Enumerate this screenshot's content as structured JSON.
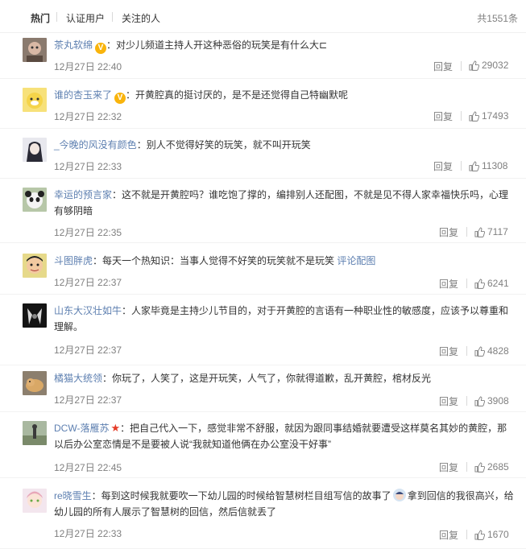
{
  "tabs": [
    "热门",
    "认证用户",
    "关注的人"
  ],
  "total": "共1551条",
  "actions": {
    "reply_label": "回复"
  },
  "colors": {
    "username_orange": "#eb7350",
    "username_blue": "#5d7fb0",
    "link": "#5d7fb0",
    "meta": "#808080"
  },
  "comments": [
    {
      "user": "茶丸软绵",
      "badge": "v-icon",
      "text": "：对少儿频道主持人开这种恶俗的玩笑是有什么大⊏",
      "time": "12月27日 22:40",
      "likes": "29032"
    },
    {
      "user": "谁的杏玉来了",
      "badge": "v-icon",
      "text": "：开黄腔真的挺讨厌的，是不是还觉得自己特幽默呢",
      "time": "12月27日 22:32",
      "likes": "17493"
    },
    {
      "user": "_今晚的风没有颜色",
      "text": "：别人不觉得好笑的玩笑，就不叫开玩笑",
      "time": "12月27日 22:33",
      "likes": "11308"
    },
    {
      "user": "幸运的预言家",
      "text": "：这不就是开黄腔吗？谁吃饱了撑的，编排别人还配图，不就是见不得人家幸福快乐吗，心理有够阴暗",
      "time": "12月27日 22:35",
      "likes": "7117"
    },
    {
      "user": "斗图胖虎",
      "text": "：每天一个热知识：当事人觉得不好笑的玩笑就不是玩笑 ",
      "link": "评论配图",
      "time": "12月27日 22:37",
      "likes": "6241"
    },
    {
      "user": "山东大汉壮如牛",
      "text": "：人家毕竟是主持少儿节目的，对于开黄腔的言语有一种职业性的敏感度，应该予以尊重和理解。",
      "time": "12月27日 22:37",
      "likes": "4828"
    },
    {
      "user": "橘猫大统领",
      "text": "：你玩了，人笑了，这是开玩笑，人气了，你就得道歉，乱开黄腔，棺材反光",
      "time": "12月27日 22:37",
      "likes": "3908"
    },
    {
      "user": "DCW-落雁苏",
      "badge": "star-icon",
      "text": "：把自己代入一下，感觉非常不舒服，就因为跟同事结婚就要遭受这样莫名其妙的黄腔，那以后办公室恋情是不是要被人说“我就知道他俩在办公室没干好事”",
      "time": "12月27日 22:45",
      "likes": "2685"
    },
    {
      "user": "re晓雪生",
      "text": "：每到这时候我就要吹一下幼儿园的时候给智慧树栏目组写信的故事了",
      "text2": "拿到回信的我很高兴，给幼儿园的所有人展示了智慧树的回信，然后信就丢了",
      "time": "12月27日 22:33",
      "likes": "1670"
    }
  ]
}
